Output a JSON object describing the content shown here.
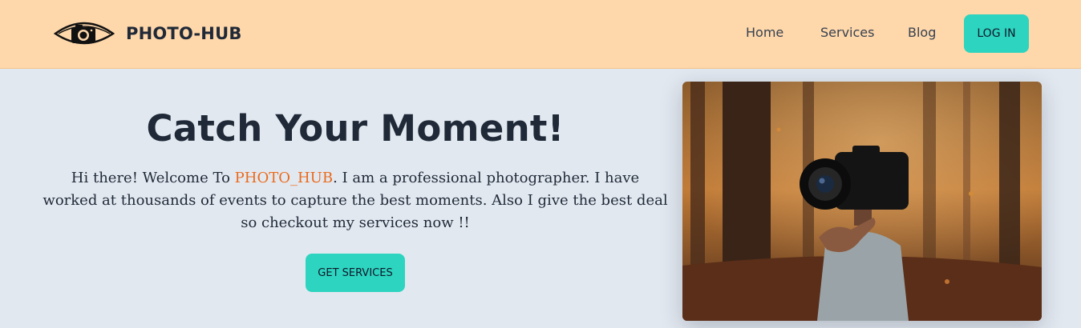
{
  "brand": {
    "logo_icon": "eye-camera-icon",
    "name": "PHOTO-HUB"
  },
  "nav": {
    "items": [
      {
        "label": "Home"
      },
      {
        "label": "Services"
      },
      {
        "label": "Blog"
      }
    ],
    "login_label": "LOG IN"
  },
  "hero": {
    "title": "Catch Your Moment!",
    "text_before": "Hi there! Welcome To ",
    "text_brand": "PHOTO_HUB",
    "text_after": ". I am a professional photographer. I have worked at thousands of events to capture the best moments. Also I give the best deal so checkout my services now !!",
    "cta_label": "GET SERVICES",
    "image_icon": "photographer-photo"
  },
  "colors": {
    "navbar_bg": "#fed7aa",
    "page_bg": "#e2e8f0",
    "accent": "#2dd4bf",
    "brand_highlight": "#ea6a1a",
    "text_dark": "#1f2937"
  }
}
